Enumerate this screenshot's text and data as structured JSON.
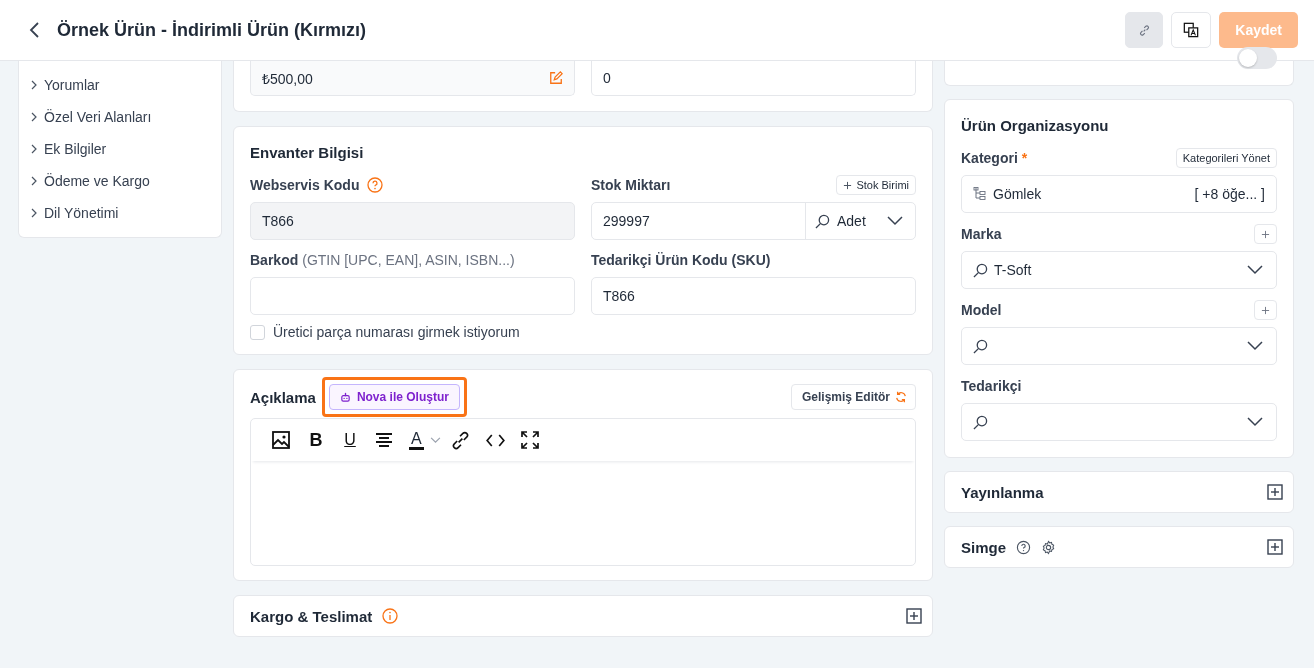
{
  "header": {
    "title": "Örnek Ürün - İndirimli Ürün (Kırmızı)",
    "save_label": "Kaydet",
    "save_disabled": true
  },
  "sidebar": {
    "items": [
      "Yorumlar",
      "Özel Veri Alanları",
      "Ek Bilgiler",
      "Ödeme ve Kargo",
      "Dil Yönetimi"
    ]
  },
  "price_card": {
    "price": "₺500,00",
    "quantity": "0"
  },
  "inventory": {
    "title": "Envanter Bilgisi",
    "webservice_label": "Webservis Kodu",
    "webservice_value": "T866",
    "stock_label": "Stok Miktarı",
    "stock_unit_button": "Stok Birimi",
    "stock_value": "299997",
    "unit": "Adet",
    "barcode_label": "Barkod",
    "barcode_hint": "(GTIN [UPC, EAN], ASIN, ISBN...)",
    "sku_label": "Tedarikçi Ürün Kodu (SKU)",
    "sku_value": "T866",
    "mpn_checkbox": {
      "label": "Üretici parça numarası girmek istiyorum",
      "checked": false
    }
  },
  "description": {
    "title": "Açıklama",
    "ai_button": "Nova ile Oluştur",
    "ai_highlighted": true,
    "editor_button": "Gelişmiş Editör",
    "toolbar": [
      {
        "kind": "image"
      },
      {
        "kind": "bold",
        "glyph": "B"
      },
      {
        "kind": "underline",
        "glyph": "U"
      },
      {
        "kind": "align"
      },
      {
        "kind": "color",
        "glyph": "A"
      },
      {
        "kind": "link"
      },
      {
        "kind": "code"
      },
      {
        "kind": "fullscreen"
      }
    ]
  },
  "shipping": {
    "title": "Kargo & Teslimat",
    "expanded": false
  },
  "price_label_card": {
    "toggle_on": false
  },
  "organization": {
    "title": "Ürün Organizasyonu",
    "category": {
      "label": "Kategori",
      "required_mark": "*",
      "manage_button": "Kategorileri Yönet",
      "value": "Gömlek",
      "more": "[ +8 öğe... ]"
    },
    "fields": [
      {
        "label": "Marka",
        "value": "T-Soft",
        "add_button": true
      },
      {
        "label": "Model",
        "add_button": true
      },
      {
        "label": "Tedarikçi",
        "add_button": false
      }
    ]
  },
  "panels": [
    {
      "title": "Yayınlanma",
      "kind": "plain",
      "expanded": false
    },
    {
      "title": "Simge",
      "kind": "icons",
      "expanded": false
    }
  ]
}
